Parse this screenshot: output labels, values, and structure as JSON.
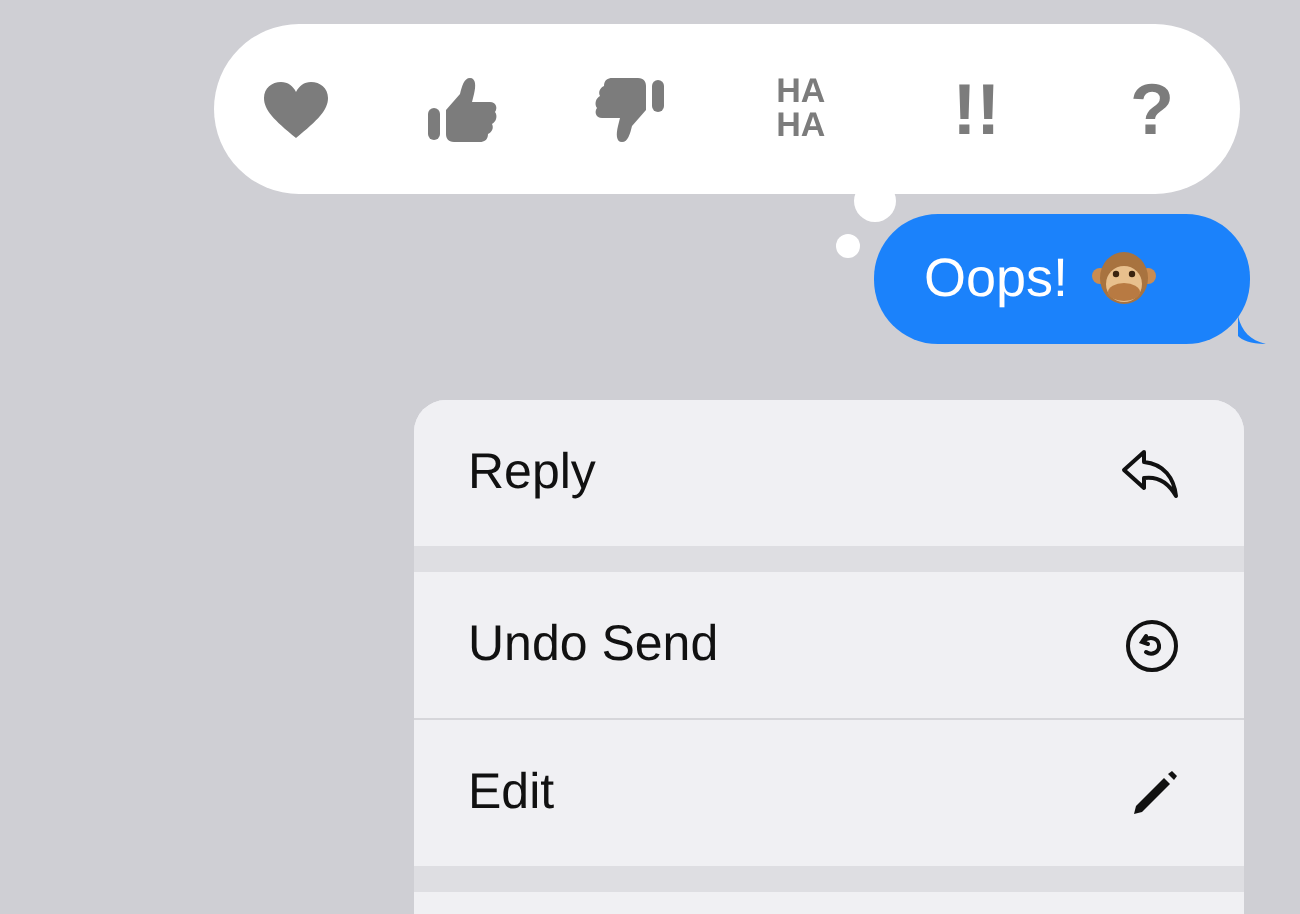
{
  "reactions": [
    {
      "kind": "heart"
    },
    {
      "kind": "thumbs-up"
    },
    {
      "kind": "thumbs-down"
    },
    {
      "kind": "text",
      "lines": [
        "HA",
        "HA"
      ]
    },
    {
      "kind": "text",
      "lines": [
        "!!"
      ]
    },
    {
      "kind": "text",
      "lines": [
        "?"
      ]
    }
  ],
  "message": {
    "text": "Oops!"
  },
  "menu": [
    {
      "label": "Reply",
      "group_end": true
    },
    {
      "label": "Undo Send",
      "group_end": false
    },
    {
      "label": "Edit",
      "group_end": true
    }
  ]
}
